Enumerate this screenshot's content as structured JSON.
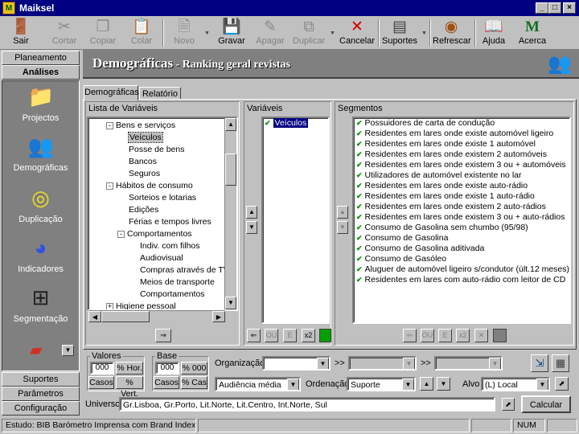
{
  "app": {
    "title": "Maiksel"
  },
  "window_controls": {
    "minimize": "_",
    "maximize": "□",
    "close": "×"
  },
  "toolbar": [
    {
      "id": "sair",
      "label": "Sair",
      "icon": "exit-door-icon",
      "glyph": "🚪",
      "enabled": true
    },
    {
      "id": "cortar",
      "label": "Cortar",
      "icon": "scissors-icon",
      "glyph": "✂",
      "enabled": false
    },
    {
      "id": "copiar",
      "label": "Copiar",
      "icon": "copy-icon",
      "glyph": "❐",
      "enabled": false
    },
    {
      "id": "colar",
      "label": "Colar",
      "icon": "paste-icon",
      "glyph": "📋",
      "enabled": false
    },
    {
      "id": "novo",
      "label": "Novo",
      "icon": "new-document-icon",
      "glyph": "🗎",
      "enabled": false
    },
    {
      "id": "gravar",
      "label": "Gravar",
      "icon": "floppy-disk-icon",
      "glyph": "💾",
      "enabled": true
    },
    {
      "id": "apagar",
      "label": "Apagar",
      "icon": "eraser-icon",
      "glyph": "✎",
      "enabled": false
    },
    {
      "id": "duplicar",
      "label": "Duplicar",
      "icon": "duplicate-icon",
      "glyph": "⧉",
      "enabled": false
    },
    {
      "id": "cancelar",
      "label": "Cancelar",
      "icon": "cancel-x-icon",
      "glyph": "✕",
      "enabled": true
    },
    {
      "id": "suportes",
      "label": "Suportes",
      "icon": "media-supports-icon",
      "glyph": "▤",
      "enabled": true
    },
    {
      "id": "refrescar",
      "label": "Refrescar",
      "icon": "refresh-globe-icon",
      "glyph": "◉",
      "enabled": true
    },
    {
      "id": "ajuda",
      "label": "Ajuda",
      "icon": "help-book-icon",
      "glyph": "📖",
      "enabled": true
    },
    {
      "id": "acerca",
      "label": "Acerca",
      "icon": "about-logo-icon",
      "glyph": "M",
      "enabled": true
    }
  ],
  "nav": {
    "top_tabs": [
      "Planeamento",
      "Análises"
    ],
    "items": [
      {
        "label": "Projectos",
        "icon": "projects-icon",
        "glyph": "📁"
      },
      {
        "label": "Demográficas",
        "icon": "demographics-people-icon",
        "glyph": "👥"
      },
      {
        "label": "Duplicação",
        "icon": "duplication-icon",
        "glyph": "◎"
      },
      {
        "label": "Indicadores",
        "icon": "indicators-icon",
        "glyph": "◕"
      },
      {
        "label": "Segmentação",
        "icon": "segmentation-network-icon",
        "glyph": "⊞"
      }
    ],
    "bottom_tabs": [
      "Suportes",
      "Parâmetros",
      "Configuração"
    ]
  },
  "header": {
    "title": "Demográficas",
    "subtitle": " - Ranking geral revistas"
  },
  "tabs": [
    "Demográficas",
    "Relatório"
  ],
  "variables_panel": {
    "title": "Lista de Variáveis",
    "tree": [
      {
        "label": "Bens e serviços",
        "level": 0,
        "exp": "-"
      },
      {
        "label": "Veículos",
        "level": 1,
        "selected": true
      },
      {
        "label": "Posse de bens",
        "level": 1
      },
      {
        "label": "Bancos",
        "level": 1
      },
      {
        "label": "Seguros",
        "level": 1
      },
      {
        "label": "Hábitos de consumo",
        "level": 0,
        "exp": "-"
      },
      {
        "label": "Sorteios e lotarias",
        "level": 1
      },
      {
        "label": "Edições",
        "level": 1
      },
      {
        "label": "Férias e tempos livres",
        "level": 1
      },
      {
        "label": "Comportamentos",
        "level": 1,
        "exp": "-"
      },
      {
        "label": "Indiv. com filhos",
        "level": 2
      },
      {
        "label": "Audiovisual",
        "level": 2
      },
      {
        "label": "Compras através de TV",
        "level": 2
      },
      {
        "label": "Meios de transporte",
        "level": 2
      },
      {
        "label": "Comportamentos",
        "level": 2
      },
      {
        "label": "Higiene pessoal",
        "level": 0,
        "exp": "+"
      }
    ]
  },
  "varsel_panel": {
    "title": "Variáveis",
    "items": [
      "Veículos"
    ]
  },
  "segments_panel": {
    "title": "Segmentos",
    "items": [
      "Possuidores de carta de condução",
      "Residentes em lares onde existe automóvel ligeiro",
      "Residentes em lares onde existe 1 automóvel",
      "Residentes em lares onde existem 2 automóveis",
      "Residentes em lares onde existem 3 ou + automóveis",
      "Utilizadores de automóvel existente no lar",
      "Residentes em lares onde existe auto-rádio",
      "Residentes em lares onde existe 1 auto-rádio",
      "Residentes em lares onde existem 2 auto-rádios",
      "Residentes em lares onde existem 3 ou + auto-rádios",
      "Consumo de Gasolina sem chumbo (95/98)",
      "Consumo de Gasolina",
      "Consumo de Gasolina aditivada",
      "Consumo de Gasóleo",
      "Aluguer de automóvel ligeiro s/condutor (últ.12 meses)",
      "Residentes em lares com auto-rádio com leitor de CD"
    ]
  },
  "mini_buttons": {
    "back": "⇐",
    "ou": "OU",
    "e": "E",
    "x2": "x2",
    "del": "✕"
  },
  "valores": {
    "title": "Valores",
    "value": "000",
    "btn_hor": "% Hor.",
    "btn_casos": "Casos",
    "btn_vert": "% Vert."
  },
  "base": {
    "title": "Base",
    "value": "000",
    "btn_000": "% 000",
    "btn_casos": "Casos",
    "btn_cas": "% Cas"
  },
  "organizacao": {
    "label": "Organização",
    "value": "",
    "sep1": ">>",
    "sep2": ">>",
    "audiencia": "Audiência média"
  },
  "ordenacao": {
    "label": "Ordenação",
    "value": "Suporte"
  },
  "alvo": {
    "label": "Alvo",
    "value": "(L) Local"
  },
  "universo": {
    "label": "Universo",
    "value": "Gr.Lisboa, Gr.Porto, Lit.Norte, Lit.Centro, Int.Norte, Sul"
  },
  "calcular": {
    "label": "Calcular"
  },
  "status": {
    "estudo": "Estudo: BIB Barómetro Imprensa com Brand Index",
    "num": "NUM"
  }
}
